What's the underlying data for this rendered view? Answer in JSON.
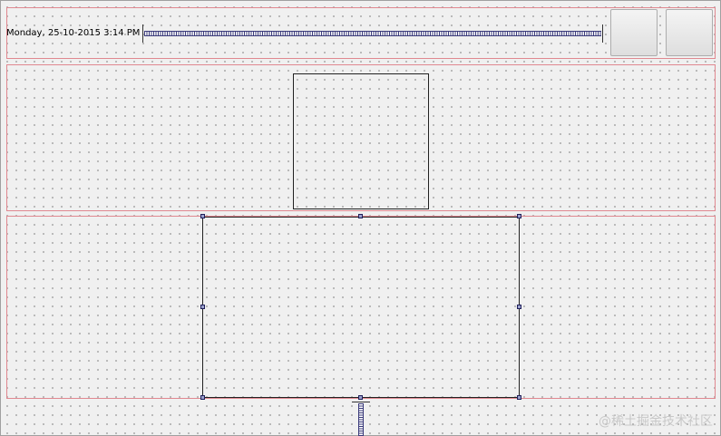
{
  "header": {
    "datetime_label": "Monday, 25-10-2015 3:14 PM",
    "buttons": [
      {
        "label": ""
      },
      {
        "label": ""
      }
    ]
  },
  "middle": {
    "frame_label": ""
  },
  "bottom": {
    "selected_widget_label": ""
  },
  "watermark": "@稀土掘金技术社区",
  "colors": {
    "layout_border": "#e08890",
    "spacer": "#3a3a7a",
    "handle_fill": "#9aa0cc",
    "canvas": "#f0f0f0"
  },
  "icons": [
    "horizontal-spacer-icon",
    "vertical-spacer-icon",
    "resize-handle-icon"
  ]
}
